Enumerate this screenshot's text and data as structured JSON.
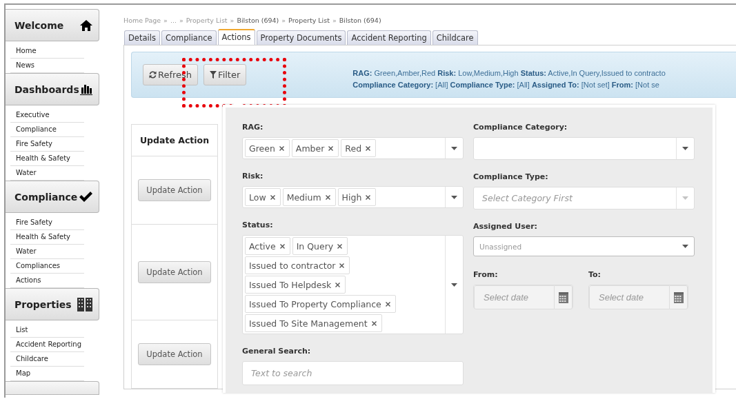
{
  "sidebar": {
    "sections": [
      {
        "title": "Welcome",
        "items": [
          {
            "label": "Home"
          },
          {
            "label": "News"
          }
        ]
      },
      {
        "title": "Dashboards",
        "items": [
          {
            "label": "Executive"
          },
          {
            "label": "Compliance"
          },
          {
            "label": "Fire Safety"
          },
          {
            "label": "Health & Safety"
          },
          {
            "label": "Water"
          }
        ]
      },
      {
        "title": "Compliance",
        "items": [
          {
            "label": "Fire Safety"
          },
          {
            "label": "Health & Safety"
          },
          {
            "label": "Water"
          },
          {
            "label": "Compliances"
          },
          {
            "label": "Actions"
          }
        ]
      },
      {
        "title": "Properties",
        "items": [
          {
            "label": "List"
          },
          {
            "label": "Accident Reporting"
          },
          {
            "label": "Childcare"
          },
          {
            "label": "Map"
          }
        ]
      }
    ]
  },
  "breadcrumb": {
    "separator": "»",
    "items": [
      "Home Page",
      "...",
      "Property List",
      "Bilston (694)",
      "Property List",
      "Bilston (694)"
    ]
  },
  "tabs": [
    {
      "label": "Details",
      "selected": false
    },
    {
      "label": "Compliance",
      "selected": false
    },
    {
      "label": "Actions",
      "selected": true
    },
    {
      "label": "Property Documents",
      "selected": false
    },
    {
      "label": "Accident Reporting",
      "selected": false
    },
    {
      "label": "Childcare",
      "selected": false
    }
  ],
  "toolbar": {
    "buttons": [
      {
        "label": "Refresh",
        "kind": "refresh"
      },
      {
        "label": "Filter",
        "kind": "filter"
      }
    ],
    "summary": [
      "**RAG:** Green,Amber,Red **Risk:** Low,Medium,High **Status:** Active,In Query,Issued to contracto",
      "**Compliance Category:** [All] **Compliance Type:** [All] **Assigned To:** [Not set] **From:** [Not se"
    ]
  },
  "table": {
    "columns": [
      "Update Action"
    ],
    "rows": [
      {
        "button": "Update Action"
      },
      {
        "button": "Update Action"
      },
      {
        "button": "Update Action"
      }
    ]
  },
  "filter_panel": {
    "left": [
      {
        "kind": "multiselect",
        "label": "RAG:",
        "tags": [
          "Green",
          "Amber",
          "Red"
        ]
      },
      {
        "kind": "multiselect",
        "label": "Risk:",
        "tags": [
          "Low",
          "Medium",
          "High"
        ]
      },
      {
        "kind": "multiselect",
        "label": "Status:",
        "tags": [
          "Active",
          "In Query",
          "Issued to contractor",
          "Issued To Helpdesk",
          "Issued To Property Compliance",
          "Issued To Site Management"
        ]
      },
      {
        "kind": "text",
        "label": "General Search:",
        "placeholder": "Text to search"
      }
    ],
    "right": [
      {
        "kind": "select",
        "label": "Compliance Category:",
        "disabled": false
      },
      {
        "kind": "select",
        "label": "Compliance Type:",
        "placeholder": "Select Category First",
        "disabled": true
      },
      {
        "kind": "select",
        "label": "Assigned User:",
        "placeholder": "Unassigned",
        "disabled": false
      },
      {
        "kind": "dates",
        "from": {
          "label": "From:",
          "placeholder": "Select date"
        },
        "to": {
          "label": "To:",
          "placeholder": "Select date"
        }
      }
    ]
  }
}
